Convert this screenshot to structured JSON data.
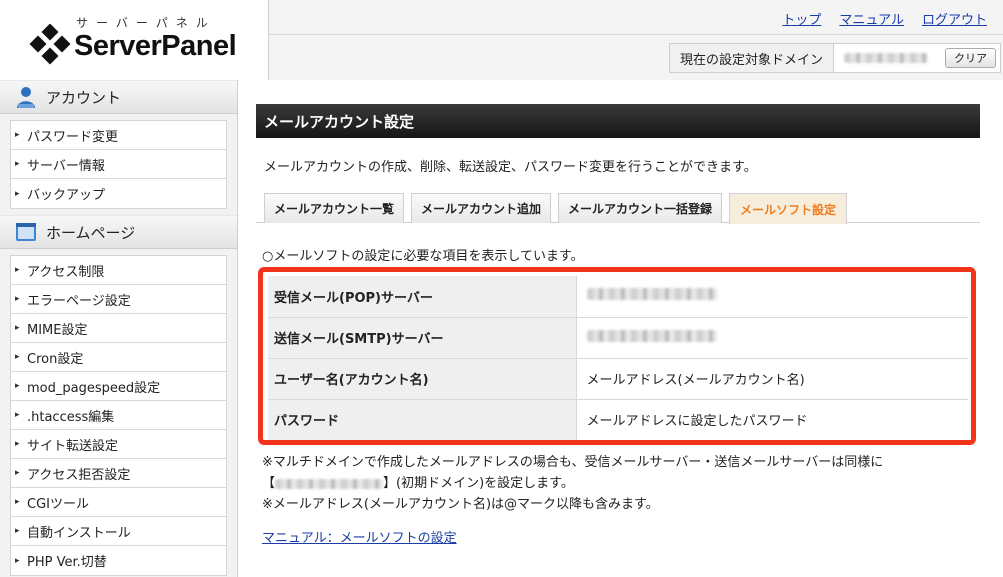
{
  "header": {
    "logo_kana": "サーバーパネル",
    "logo_text": "ServerPanel",
    "links": [
      "トップ",
      "マニュアル",
      "ログアウト"
    ],
    "domain_label": "現在の設定対象ドメイン",
    "clear_label": "クリア"
  },
  "sidebar": {
    "sections": [
      {
        "title": "アカウント",
        "icon": "person-icon",
        "items": [
          "パスワード変更",
          "サーバー情報",
          "バックアップ"
        ]
      },
      {
        "title": "ホームページ",
        "icon": "window-icon",
        "items": [
          "アクセス制限",
          "エラーページ設定",
          "MIME設定",
          "Cron設定",
          "mod_pagespeed設定",
          ".htaccess編集",
          "サイト転送設定",
          "アクセス拒否設定",
          "CGIツール",
          "自動インストール",
          "PHP Ver.切替"
        ]
      }
    ]
  },
  "main": {
    "title": "メールアカウント設定",
    "description": "メールアカウントの作成、削除、転送設定、パスワード変更を行うことができます。",
    "tabs": [
      "メールアカウント一覧",
      "メールアカウント追加",
      "メールアカウント一括登録",
      "メールソフト設定"
    ],
    "active_tab": 3,
    "note": "○メールソフトの設定に必要な項目を表示しています。",
    "table": [
      {
        "key": "受信メール(POP)サーバー",
        "value": ""
      },
      {
        "key": "送信メール(SMTP)サーバー",
        "value": ""
      },
      {
        "key": "ユーザー名(アカウント名)",
        "value": "メールアドレス(メールアカウント名)"
      },
      {
        "key": "パスワード",
        "value": "メールアドレスに設定したパスワード"
      }
    ],
    "footnote1": "※マルチドメインで作成したメールアドレスの場合も、受信メールサーバー・送信メールサーバーは同様に",
    "footnote2_prefix": "【",
    "footnote2_suffix": "】(初期ドメイン)を設定します。",
    "footnote3": "※メールアドレス(メールアカウント名)は@マーク以降も含みます。",
    "manual_link": "マニュアル：メールソフトの設定"
  },
  "colors": {
    "accent_tab": "#f07c1e",
    "highlight_frame": "#f2341c",
    "link": "#1a3da8"
  }
}
